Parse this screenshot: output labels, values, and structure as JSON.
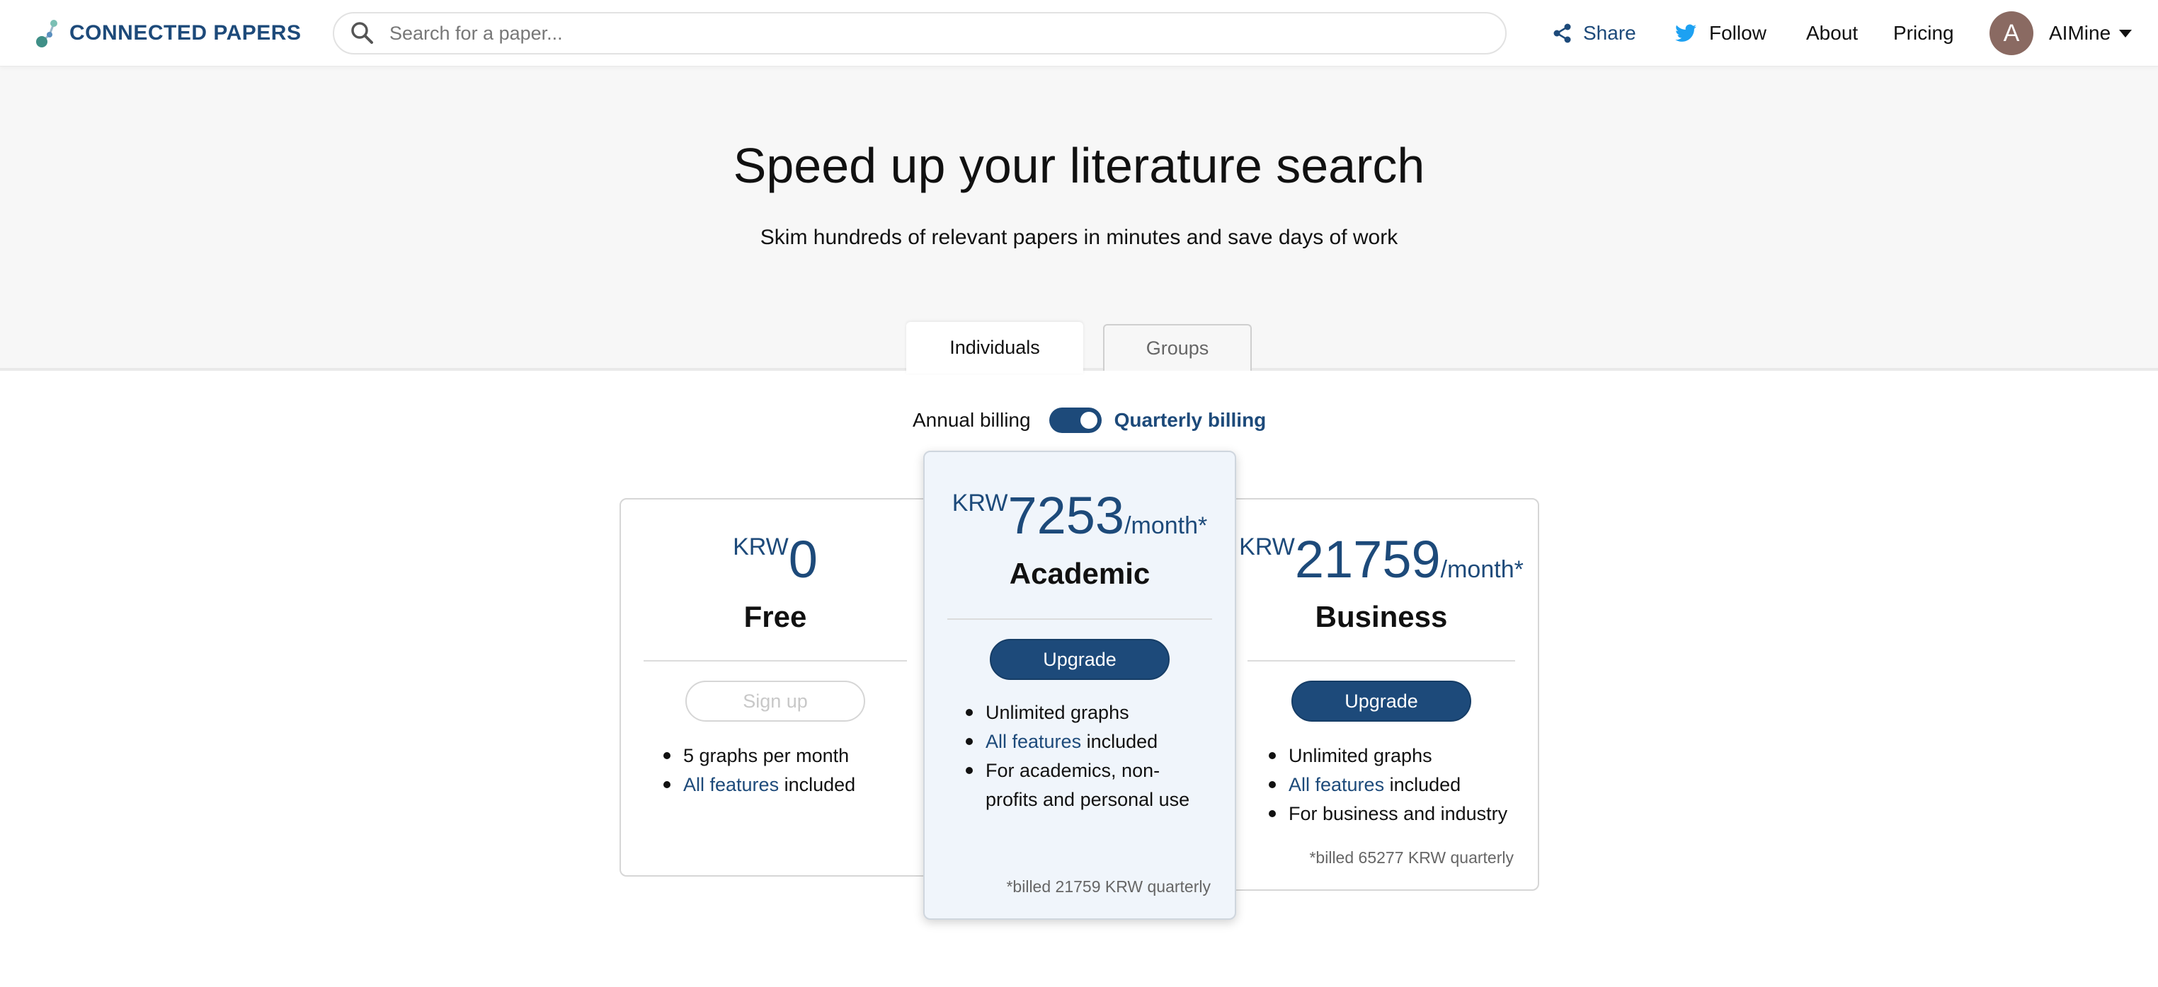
{
  "header": {
    "logo_text": "CONNECTED PAPERS",
    "search_placeholder": "Search for a paper...",
    "nav": {
      "share": "Share",
      "follow": "Follow",
      "about": "About",
      "pricing": "Pricing"
    },
    "user": {
      "avatar_letter": "A",
      "name": "AIMine"
    }
  },
  "hero": {
    "title": "Speed up your literature search",
    "subtitle": "Skim hundreds of relevant papers in minutes and save days of work"
  },
  "tabs": [
    {
      "label": "Individuals",
      "active": true
    },
    {
      "label": "Groups",
      "active": false
    }
  ],
  "billing": {
    "annual_label": "Annual billing",
    "quarterly_label": "Quarterly billing",
    "quarterly_selected": true
  },
  "plans": {
    "free": {
      "currency": "KRW",
      "amount": "0",
      "name": "Free",
      "button": "Sign up",
      "features": [
        {
          "text": "5 graphs per month"
        },
        {
          "link": "All features",
          "text": " included"
        }
      ]
    },
    "academic": {
      "currency": "KRW",
      "amount": "7253",
      "period": "/month*",
      "name": "Academic",
      "button": "Upgrade",
      "features": [
        {
          "text": "Unlimited graphs"
        },
        {
          "link": "All features",
          "text": " included"
        },
        {
          "text": "For academics, non-profits and personal use"
        }
      ],
      "footnote": "*billed 21759 KRW quarterly"
    },
    "business": {
      "currency": "KRW",
      "amount": "21759",
      "period": "/month*",
      "name": "Business",
      "button": "Upgrade",
      "features": [
        {
          "text": "Unlimited graphs"
        },
        {
          "link": "All features",
          "text": " included"
        },
        {
          "text": "For business and industry"
        }
      ],
      "footnote": "*billed 65277 KRW quarterly"
    }
  },
  "colors": {
    "brand": "#1d4a7a",
    "twitter": "#1da1f2",
    "hero_bg": "#f7f7f7",
    "academic_bg": "#f0f5fb"
  }
}
